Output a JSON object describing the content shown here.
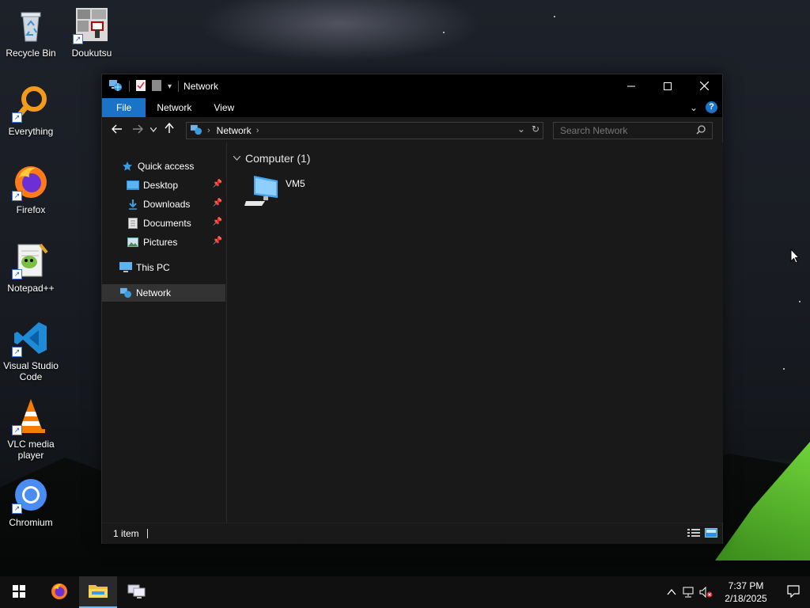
{
  "desktop": {
    "icons": [
      {
        "label": "Recycle Bin",
        "icon": "recycle-bin-icon"
      },
      {
        "label": "Doukutsu",
        "icon": "doukutsu-icon"
      },
      {
        "label": "Everything",
        "icon": "everything-search-icon"
      },
      {
        "label": "Firefox",
        "icon": "firefox-icon"
      },
      {
        "label": "Notepad++",
        "icon": "notepad-plus-plus-icon"
      },
      {
        "label": "Visual Studio Code",
        "icon": "vscode-icon"
      },
      {
        "label": "VLC media player",
        "icon": "vlc-icon"
      },
      {
        "label": "Chromium",
        "icon": "chromium-icon"
      }
    ]
  },
  "window": {
    "title": "Network",
    "ribbon": {
      "tabs": [
        "File",
        "Network",
        "View"
      ]
    },
    "address": {
      "crumb": "Network"
    },
    "search": {
      "placeholder": "Search Network"
    },
    "sidebar": {
      "quick_access": "Quick access",
      "items": [
        {
          "label": "Desktop",
          "pinned": true
        },
        {
          "label": "Downloads",
          "pinned": true
        },
        {
          "label": "Documents",
          "pinned": true
        },
        {
          "label": "Pictures",
          "pinned": true
        }
      ],
      "this_pc": "This PC",
      "network": "Network"
    },
    "content": {
      "group_header": "Computer (1)",
      "items": [
        {
          "label": "VM5",
          "icon": "computer-icon"
        }
      ]
    },
    "status": {
      "count": "1 item"
    }
  },
  "taskbar": {
    "clock": {
      "time": "7:37 PM",
      "date": "2/18/2025"
    }
  },
  "colors": {
    "accent": "#1a73c7",
    "window_bg": "#191919",
    "titlebar_bg": "#000000",
    "taskbar_bg": "#101010"
  }
}
